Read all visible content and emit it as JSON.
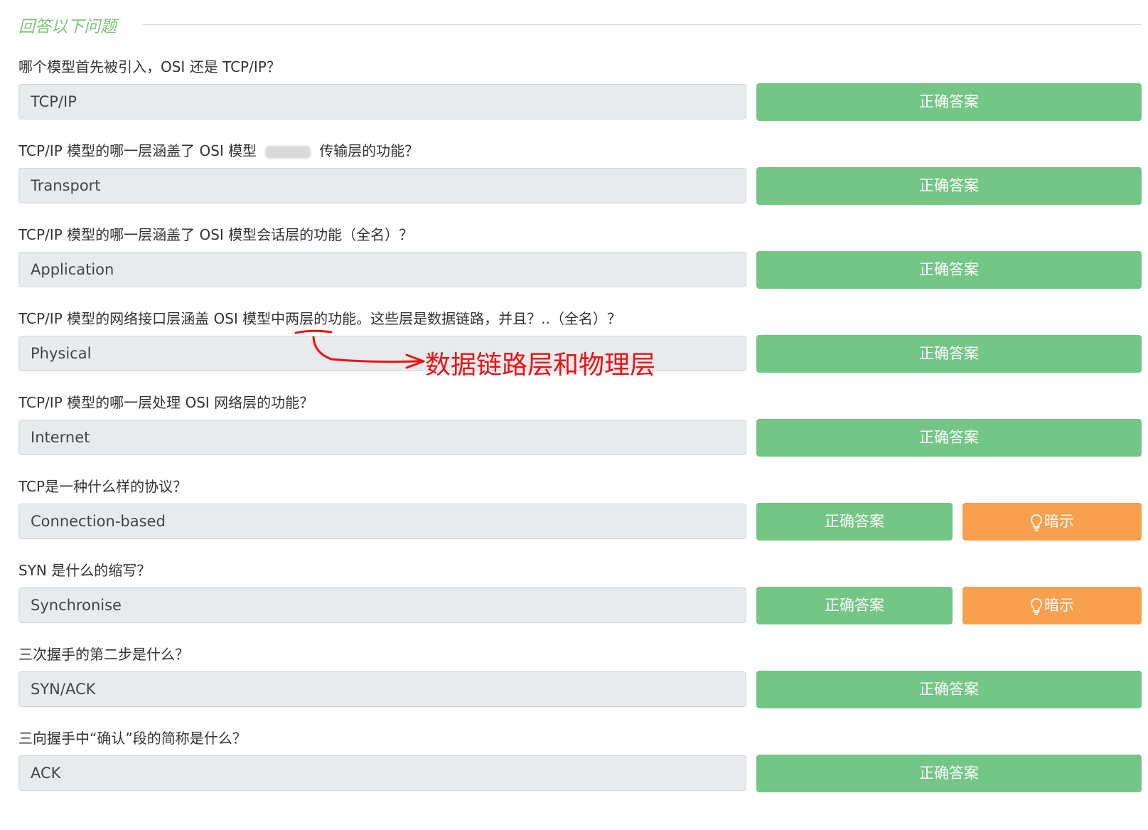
{
  "section": {
    "title": "回答以下问题"
  },
  "labels": {
    "correct_answer": "正确答案",
    "hint": "暗示"
  },
  "questions": [
    {
      "question": "哪个模型首先被引入，OSI 还是 TCP/IP？",
      "answer": "TCP/IP",
      "has_hint": false
    },
    {
      "question_before": "TCP/IP 模型的哪一层涵盖了 OSI 模型",
      "question_after": "传输层的功能？",
      "answer": "Transport",
      "has_hint": false
    },
    {
      "question": "TCP/IP 模型的哪一层涵盖了 OSI 模型会话层的功能（全名）？",
      "answer": "Application",
      "has_hint": false
    },
    {
      "question": "TCP/IP 模型的网络接口层涵盖 OSI 模型中两层的功能。这些层是数据链路，并且？..（全名）？",
      "answer": "Physical",
      "has_hint": false
    },
    {
      "question": "TCP/IP 模型的哪一层处理 OSI 网络层的功能？",
      "answer": "Internet",
      "has_hint": false
    },
    {
      "question": "TCP是一种什么样的协议？",
      "answer": "Connection-based",
      "has_hint": true
    },
    {
      "question": "SYN 是什么的缩写？",
      "answer": "Synchronise",
      "has_hint": true
    },
    {
      "question": "三次握手的第二步是什么？",
      "answer": "SYN/ACK",
      "has_hint": false
    },
    {
      "question": "三向握手中“确认”段的简称是什么？",
      "answer": "ACK",
      "has_hint": false
    }
  ],
  "annotation": {
    "text": "数据链路层和物理层",
    "color": "#ee1111"
  },
  "colors": {
    "correct_button": "#73c685",
    "hint_button": "#f9a04f",
    "title": "#7cc576",
    "answer_bg": "#e8ebed"
  }
}
